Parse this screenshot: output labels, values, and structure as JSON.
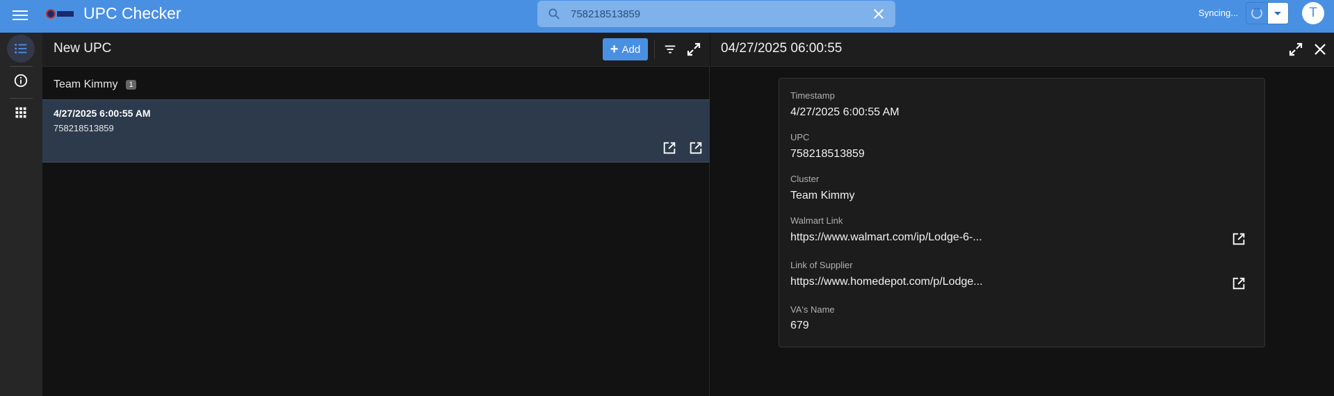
{
  "topbar": {
    "title": "UPC Checker",
    "search_value": "758218513859",
    "sync_status": "Syncing...",
    "avatar_initial": "T"
  },
  "rail": {
    "items": [
      {
        "icon": "list-icon",
        "active": true
      },
      {
        "icon": "info-icon",
        "active": false
      },
      {
        "icon": "apps-grid-icon",
        "active": false
      }
    ]
  },
  "list_pane": {
    "title": "New UPC",
    "add_label": "Add",
    "group": {
      "name": "Team Kimmy",
      "count": "1"
    },
    "records": [
      {
        "timestamp": "4/27/2025 6:00:55 AM",
        "upc": "758218513859"
      }
    ]
  },
  "detail_pane": {
    "title": "04/27/2025 06:00:55",
    "fields": {
      "timestamp": {
        "label": "Timestamp",
        "value": "4/27/2025 6:00:55 AM"
      },
      "upc": {
        "label": "UPC",
        "value": "758218513859"
      },
      "cluster": {
        "label": "Cluster",
        "value": "Team Kimmy"
      },
      "walmart_link": {
        "label": "Walmart Link",
        "value": "https://www.walmart.com/ip/Lodge-6-..."
      },
      "supplier_link": {
        "label": "Link of Supplier",
        "value": "https://www.homedepot.com/p/Lodge..."
      },
      "va_name": {
        "label": "VA's Name",
        "value": "679"
      }
    }
  },
  "colors": {
    "accent": "#4a90e2",
    "selected_row": "#2c3a4c",
    "background": "#121212"
  }
}
